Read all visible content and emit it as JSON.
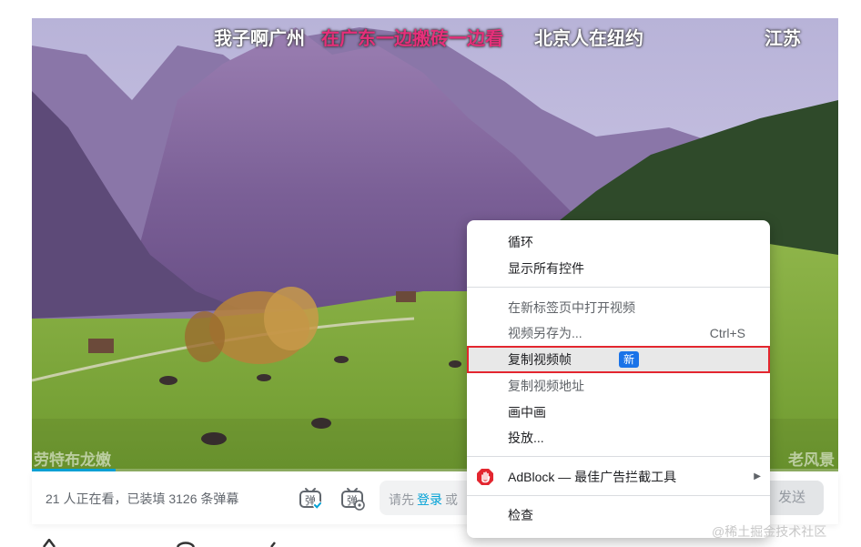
{
  "video": {
    "danmaku": [
      "我子啊广州",
      "在广东一边搬砖一边看",
      "北京人在纽约",
      "江苏"
    ],
    "watermark_left": "劳特布龙嫩",
    "watermark_right": "老风景",
    "progress_fraction": 0.104
  },
  "send_bar": {
    "viewers_text": "21 人正在看，已装填 3126 条弹幕",
    "toggle_icon": "danmaku-toggle-icon",
    "settings_icon": "danmaku-settings-icon",
    "input_prefix": "请先",
    "login_link": "登录",
    "input_suffix": "或",
    "send_label": "发送"
  },
  "context_menu": {
    "items": [
      {
        "label": "循环"
      },
      {
        "label": "显示所有控件"
      },
      {
        "label": "在新标签页中打开视频"
      },
      {
        "label": "视频另存为...",
        "shortcut": "Ctrl+S"
      },
      {
        "label": "复制视频帧",
        "badge": "新"
      },
      {
        "label": "复制视频地址"
      },
      {
        "label": "画中画"
      },
      {
        "label": "投放..."
      },
      {
        "label": "AdBlock — 最佳广告拦截工具",
        "icon": "adblock-hand-icon"
      },
      {
        "label": "检查"
      }
    ]
  },
  "corner_watermark": "@稀土掘金技术社区",
  "colors": {
    "accent": "#00a1d6",
    "highlight_border": "#e3262f",
    "badge": "#1a73e8",
    "danmaku_pink": "#e62f7a"
  }
}
